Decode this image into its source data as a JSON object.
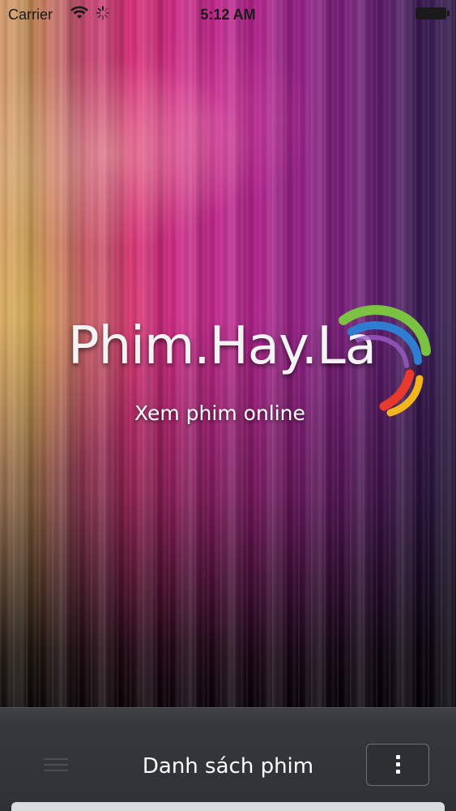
{
  "status_bar": {
    "carrier": "Carrier",
    "time": "5:12 AM"
  },
  "splash": {
    "logo_text": "Phim.Hay.La",
    "tagline": "Xem phim online"
  },
  "toolbar": {
    "title": "Danh sách phim"
  },
  "colors": {
    "toolbar_bg": "#34383b",
    "logo_text": "#f3f3f3",
    "swoosh_green": "#7cc242",
    "swoosh_blue": "#2f7dd1",
    "swoosh_red": "#e63a2e",
    "swoosh_yellow": "#f2b51d"
  },
  "icons": {
    "menu": "hamburger-menu-icon",
    "more": "vertical-dots-icon",
    "wifi": "wifi-icon",
    "activity": "activity-spinner-icon",
    "battery": "battery-icon"
  }
}
